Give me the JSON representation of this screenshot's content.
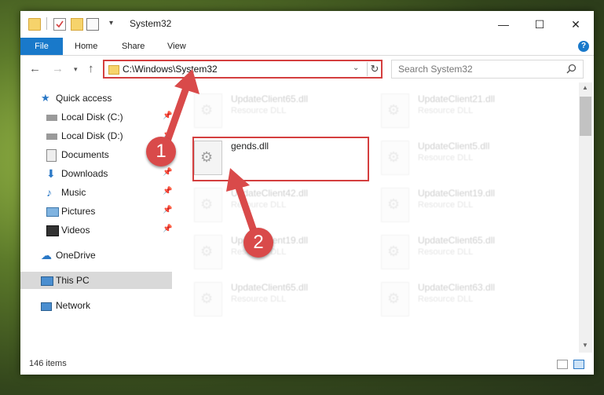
{
  "window": {
    "title": "System32",
    "minimize_glyph": "—",
    "maximize_glyph": "☐",
    "close_glyph": "✕"
  },
  "ribbon": {
    "tabs": [
      "File",
      "Home",
      "Share",
      "View"
    ],
    "help_glyph": "?"
  },
  "address": {
    "path": "C:\\Windows\\System32",
    "search_placeholder": "Search System32"
  },
  "sidebar": {
    "items": [
      {
        "label": "Quick access",
        "icon": "star-icon",
        "pinned": false
      },
      {
        "label": "Local Disk (C:)",
        "icon": "drive-icon",
        "pinned": true
      },
      {
        "label": "Local Disk (D:)",
        "icon": "drive-icon",
        "pinned": true
      },
      {
        "label": "Documents",
        "icon": "documents-icon",
        "pinned": true
      },
      {
        "label": "Downloads",
        "icon": "download-icon",
        "pinned": true
      },
      {
        "label": "Music",
        "icon": "music-icon",
        "pinned": true
      },
      {
        "label": "Pictures",
        "icon": "pictures-icon",
        "pinned": true
      },
      {
        "label": "Videos",
        "icon": "videos-icon",
        "pinned": true
      },
      {
        "label": "OneDrive",
        "icon": "cloud-icon",
        "pinned": false
      },
      {
        "label": "This PC",
        "icon": "computer-icon",
        "pinned": false,
        "selected": true
      },
      {
        "label": "Network",
        "icon": "network-icon",
        "pinned": false
      }
    ]
  },
  "files": {
    "highlighted": {
      "name": "gends.dll",
      "type": ""
    },
    "background": [
      {
        "name": "UpdateClient65.dll",
        "type": "Resource DLL"
      },
      {
        "name": "UpdateClient21.dll",
        "type": "Resource DLL"
      },
      {
        "name": "UpdateClient5.dll",
        "type": "Resource DLL"
      },
      {
        "name": "UpdateClient42.dll",
        "type": "Resource DLL"
      },
      {
        "name": "UpdateClient19.dll",
        "type": "Resource DLL"
      },
      {
        "name": "UpdateClient19.dll",
        "type": "Resource DLL"
      },
      {
        "name": "UpdateClient65.dll",
        "type": "Resource DLL"
      },
      {
        "name": "UpdateClient65.dll",
        "type": "Resource DLL"
      },
      {
        "name": "UpdateClient63.dll",
        "type": "Resource DLL"
      }
    ]
  },
  "status": {
    "item_count": "146 items"
  },
  "markers": {
    "one": "1",
    "two": "2"
  },
  "colors": {
    "accent": "#1979ca",
    "highlight": "#d43f3f",
    "marker": "#d94a4a"
  }
}
